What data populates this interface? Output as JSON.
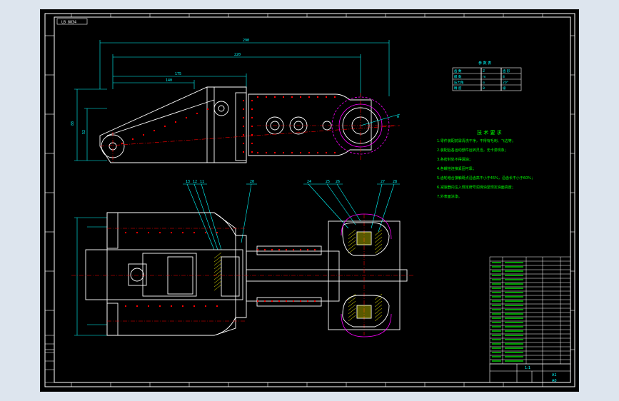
{
  "colors": {
    "window_bg": "#dde5ee",
    "canvas_bg": "#000000",
    "frame": "#ffffff",
    "dimension": "#00ffff",
    "outline": "#ffffff",
    "center_line": "#ff0000",
    "notes_text": "#00ff00",
    "circle_magenta": "#ff00ff",
    "table_line": "#ffffff",
    "highlight": "#ffff00"
  },
  "title_tag": "LB 8834",
  "top_view": {
    "dimensions": [
      "290",
      "220",
      "175",
      "140",
      "88",
      "52"
    ],
    "callouts": [
      "A"
    ]
  },
  "section_view": {
    "callouts": [
      "13",
      "12",
      "11",
      "20",
      "24",
      "25",
      "26",
      "27",
      "28"
    ]
  },
  "param_table": {
    "title": "参 数 表",
    "rows": [
      [
        "齿 数",
        "Z",
        "齿 形"
      ],
      [
        "模 数",
        "m",
        "8"
      ],
      [
        "压力角",
        "α",
        "20°"
      ],
      [
        "精 度",
        "8",
        "级"
      ]
    ]
  },
  "tech_notes": {
    "title": "技 术 要 求",
    "lines": [
      "1.零件装配前需清洗干净，不得有毛刺、飞边等；",
      "2.装配后各运动部件运转灵活，无卡滞现象；",
      "3.各密封处不得漏油；",
      "4.各螺栓连接紧固可靠；",
      "5.齿轮啮合接触斑点沿齿高不小于45%，沿齿长不小于60%；",
      "6.减速器内注入规定牌号润滑油至规定油面高度；",
      "7.外表面涂漆。"
    ]
  },
  "title_block": {
    "scale": "1:1",
    "sheet": "A1",
    "drawing_no": "A0"
  }
}
